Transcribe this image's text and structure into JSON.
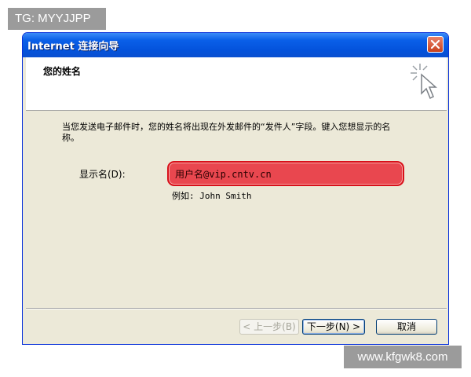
{
  "watermark": {
    "top": "TG: MYYJJPP",
    "bottom": "www.kfgwk8.com"
  },
  "window": {
    "title": "Internet 连接向导"
  },
  "header": {
    "title": "您的姓名",
    "icon": "wizard-cursor-icon"
  },
  "body": {
    "description": "当您发送电子邮件时，您的姓名将出现在外发邮件的“发件人”字段。键入您想显示的名称。",
    "display_name_label": "显示名(D):",
    "display_name_value": "用户名@vip.cntv.cn",
    "example": "例如: John Smith"
  },
  "buttons": {
    "back": "< 上一步(B)",
    "next": "下一步(N) >",
    "cancel": "取消"
  },
  "colors": {
    "title_bar": "#0a5fe8",
    "highlight": "#e9474f",
    "dialog_bg": "#ece9d8"
  }
}
